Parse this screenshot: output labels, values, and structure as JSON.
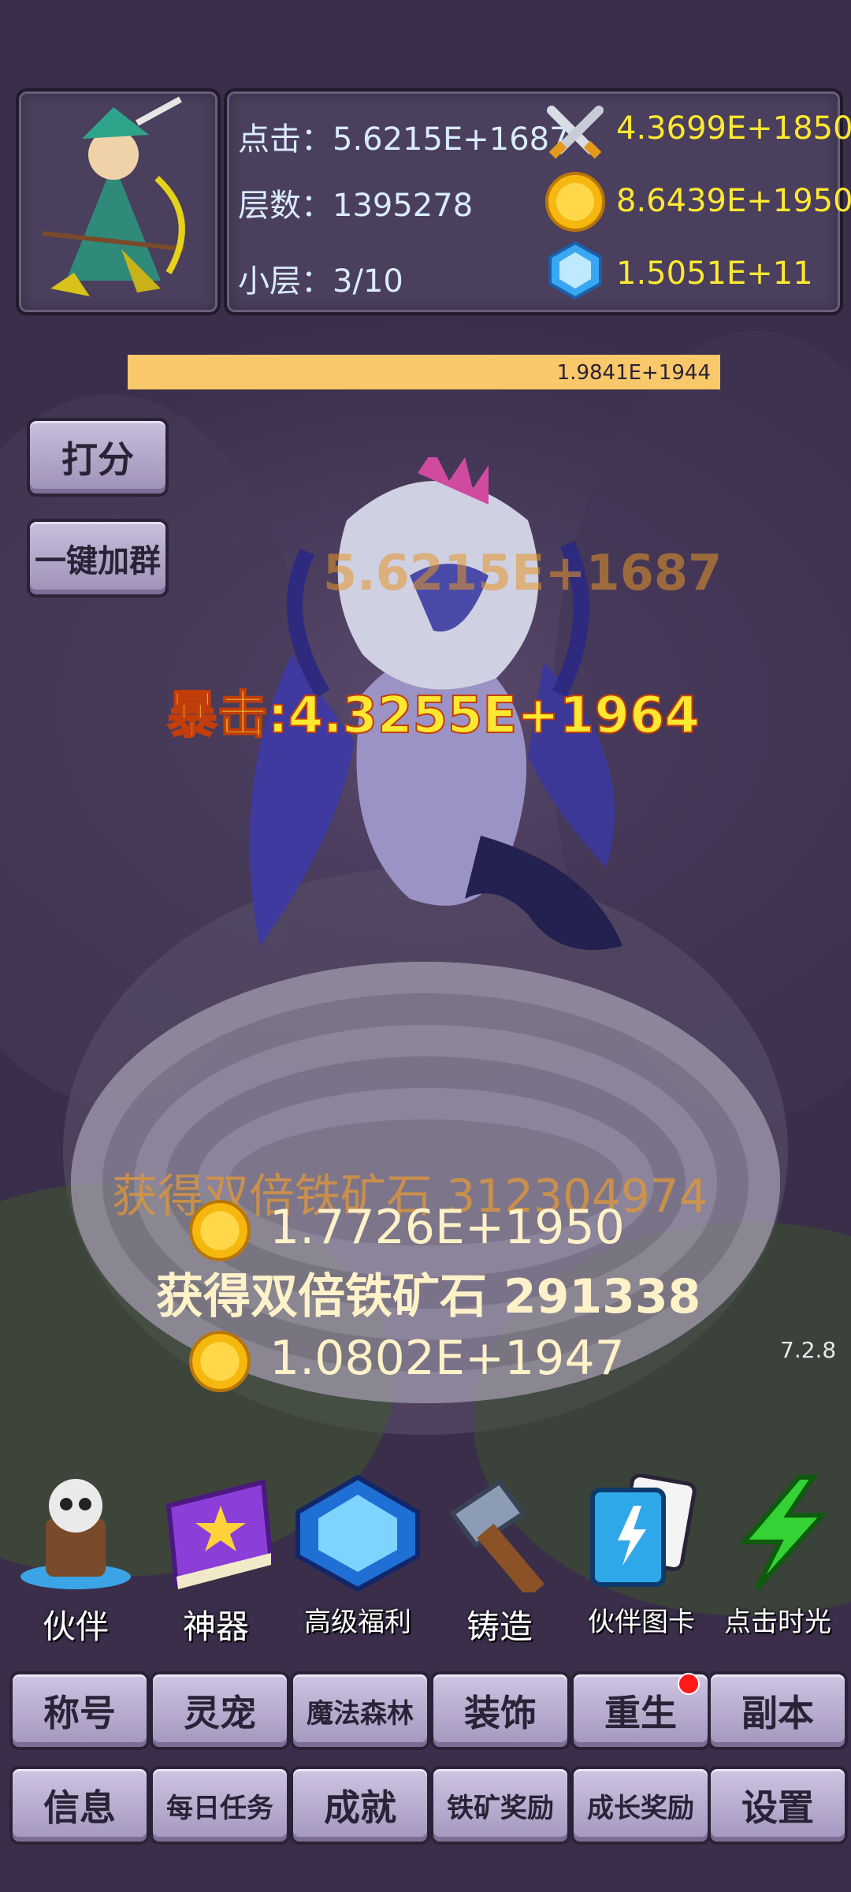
{
  "hero": {
    "portrait_icon": "archer-hero-portrait"
  },
  "stats": {
    "click_label": "点击：5.6215E+1687",
    "floor_label": "层数：1395278",
    "sublayer_label": "小层：3/10",
    "attack_value": "4.3699E+1850",
    "gold_value": "8.6439E+1950",
    "diamond_value": "1.5051E+11"
  },
  "boss": {
    "hp_text": "1.9841E+1944",
    "hp_fraction": 1.0,
    "name_icon": "sea-serpent-dragon"
  },
  "side_buttons": {
    "rate": "打分",
    "join_group": "一键加群"
  },
  "combat": {
    "faded_damage": "5.6215E+1687",
    "crit_text": "暴击:4.3255E+1964",
    "ore_reward_1": "获得双倍铁矿石 312304974",
    "gold_reward_1": "1.7726E+1950",
    "ore_reward_2": "获得双倍铁矿石 291338",
    "gold_reward_2": "1.0802E+1947"
  },
  "version": "7.2.8",
  "menu": [
    {
      "label": "伙伴",
      "icon": "skull-partner-icon"
    },
    {
      "label": "神器",
      "icon": "purple-book-icon"
    },
    {
      "label": "高级福利",
      "icon": "blue-gem-icon"
    },
    {
      "label": "铸造",
      "icon": "hammer-icon"
    },
    {
      "label": "伙伴图卡",
      "icon": "cards-icon"
    },
    {
      "label": "点击时光",
      "icon": "lightning-icon"
    }
  ],
  "row1": [
    "称号",
    "灵宠",
    "魔法森林",
    "装饰",
    "重生",
    "副本"
  ],
  "row2": [
    "信息",
    "每日任务",
    "成就",
    "铁矿奖励",
    "成长奖励",
    "设置"
  ],
  "colors": {
    "accent_yellow": "#ffe832",
    "hp_bar": "#f9c86a",
    "notify_dot": "#ff1a1a"
  }
}
